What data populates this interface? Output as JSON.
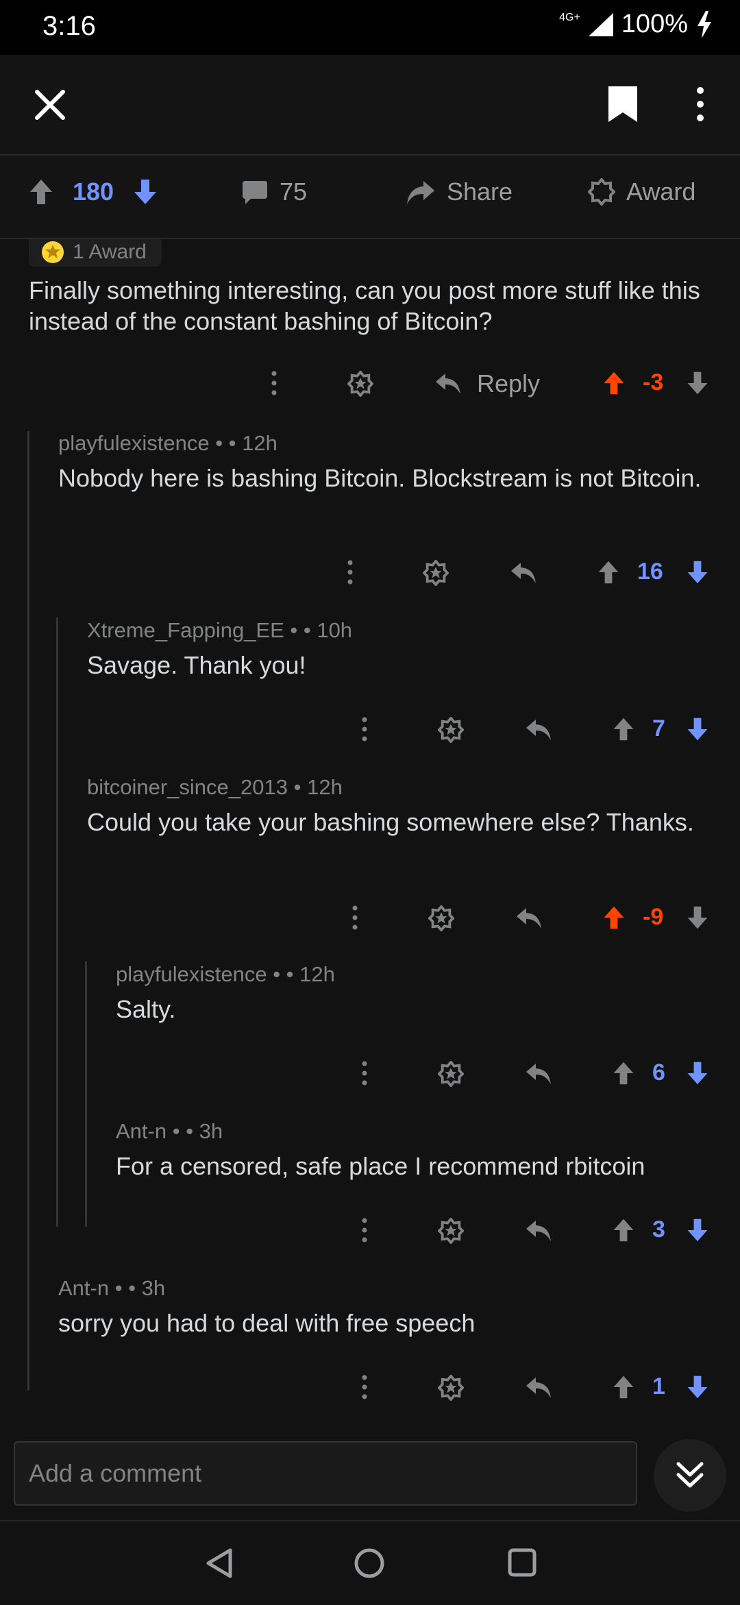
{
  "status_bar": {
    "time": "3:16",
    "network": "4G+",
    "battery": "100%"
  },
  "toolbar": {
    "close_icon": "close-icon",
    "bookmark_icon": "bookmark-icon",
    "more_icon": "more-vertical-icon"
  },
  "post_actions": {
    "score": "180",
    "comments": "75",
    "share_label": "Share",
    "award_label": "Award"
  },
  "comments": [
    {
      "award_text": "1 Award",
      "body": "Finally something interesting, can you post more stuff like this instead of the constant bashing of Bitcoin?",
      "reply_label": "Reply",
      "score": "-3",
      "vote_state": "upvoted"
    },
    {
      "author": "playfulexistence",
      "age": "12h",
      "body": "Nobody here is bashing Bitcoin. Blockstream is not Bitcoin.",
      "score": "16",
      "vote_state": "downvoted"
    },
    {
      "author": "Xtreme_Fapping_EE",
      "age": "10h",
      "body": "Savage. Thank you!",
      "score": "7",
      "vote_state": "downvoted"
    },
    {
      "author": "bitcoiner_since_2013",
      "age": "12h",
      "body": "Could you take your bashing somewhere else? Thanks.",
      "score": "-9",
      "vote_state": "upvoted"
    },
    {
      "author": "playfulexistence",
      "age": "12h",
      "body": "Salty.",
      "score": "6",
      "vote_state": "downvoted"
    },
    {
      "author": "Ant-n",
      "age": "3h",
      "body": "For a censored, safe place I recommend rbitcoin",
      "score": "3",
      "vote_state": "downvoted"
    },
    {
      "author": "Ant-n",
      "age": "3h",
      "body": "sorry you had to deal with free speech",
      "score": "1",
      "vote_state": "downvoted"
    }
  ],
  "composer": {
    "placeholder": "Add a comment"
  },
  "colors": {
    "upvote": "#ff4500",
    "downvote": "#7193ff",
    "background": "#121212"
  }
}
